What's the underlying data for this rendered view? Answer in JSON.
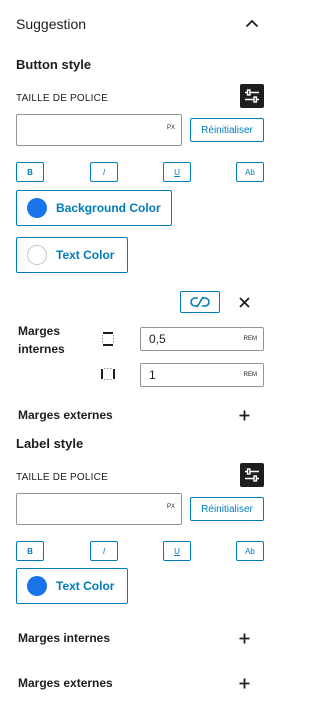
{
  "panel": {
    "title": "Suggestion"
  },
  "button_style": {
    "title": "Button style",
    "font_size_label": "TAILLE DE POLICE",
    "font_size_value": "",
    "font_size_unit": "PX",
    "reset_label": "Réinitialiser",
    "format_buttons": {
      "bold": "B",
      "italic": "I",
      "underline": "U",
      "case": "Ab"
    },
    "background_color_label": "Background Color",
    "background_color": "#1a73e8",
    "text_color_label": "Text Color",
    "text_color": "#ffffff",
    "padding": {
      "label": "Marges internes",
      "vertical_value": "0,5",
      "horizontal_value": "1",
      "unit": "REM"
    },
    "margin_label": "Marges externes"
  },
  "label_style": {
    "title": "Label style",
    "font_size_label": "TAILLE DE POLICE",
    "font_size_value": "",
    "font_size_unit": "PX",
    "reset_label": "Réinitialiser",
    "format_buttons": {
      "bold": "B",
      "italic": "I",
      "underline": "U",
      "case": "Ab"
    },
    "text_color_label": "Text Color",
    "text_color": "#1a73e8",
    "padding_label": "Marges internes",
    "margin_label": "Marges externes"
  },
  "colors": {
    "accent": "#007cba",
    "text": "#1e1e1e"
  }
}
